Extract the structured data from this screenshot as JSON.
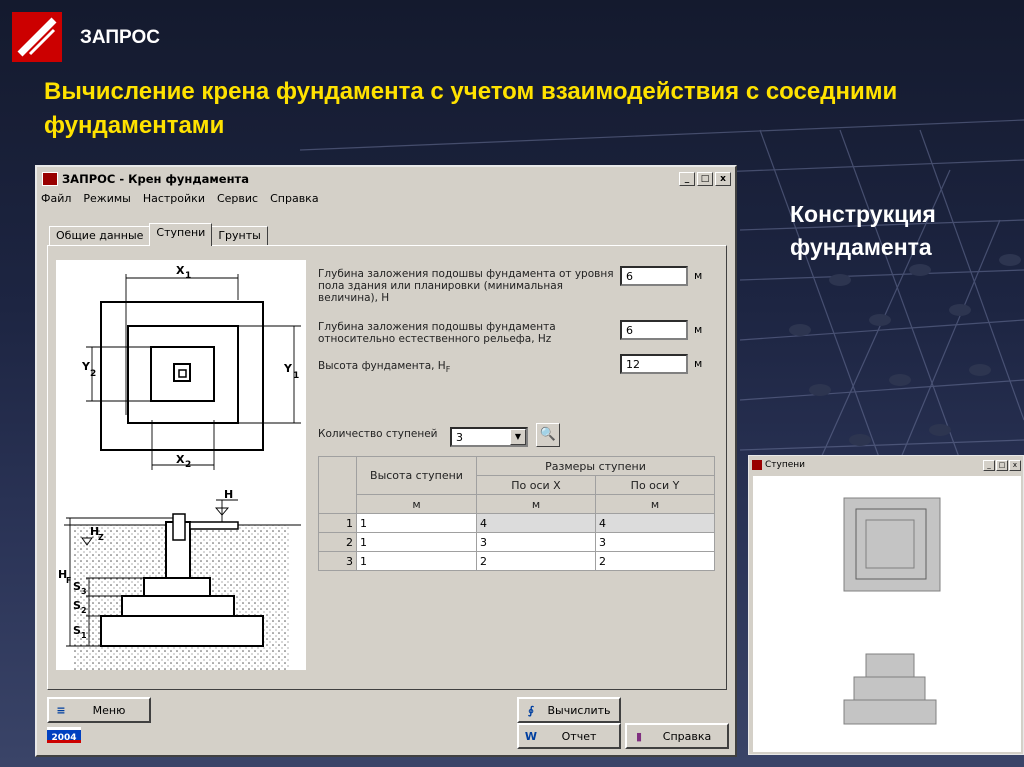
{
  "slide": {
    "tag": "ЗАПРОС",
    "title": "Вычисление крена фундамента с учетом взаимодействия с соседними фундаментами",
    "side_caption_line1": "Конструкция",
    "side_caption_line2": "фундамента"
  },
  "window": {
    "title": "ЗАПРОС - Крен фундамента",
    "controls": [
      "_",
      "□",
      "x"
    ],
    "menu": [
      "Файл",
      "Режимы",
      "Настройки",
      "Сервис",
      "Справка"
    ],
    "tabs": [
      "Общие данные",
      "Ступени",
      "Грунты"
    ],
    "active_tab": "Ступени"
  },
  "drawing": {
    "plan_labels": {
      "x1": "X",
      "x1_sub": "1",
      "x2": "X",
      "x2_sub": "2",
      "y1": "Y",
      "y1_sub": "1",
      "y2": "Y",
      "y2_sub": "2"
    },
    "section_labels": {
      "h": "H",
      "hz": "H",
      "hz_sub": "Z",
      "hf": "H",
      "hf_sub": "F",
      "s1": "S",
      "s1_sub": "1",
      "s2": "S",
      "s2_sub": "2",
      "s3": "S",
      "s3_sub": "3"
    }
  },
  "fields": [
    {
      "label_line1": "Глубина заложения подошвы фундамента от уровня",
      "label_line2": "пола здания или планировки (минимальная",
      "label_line3": "величина), H",
      "value": "6",
      "unit": "м"
    },
    {
      "label_line1": "Глубина заложения подошвы фундамента",
      "label_line2": "относительно естественного рельефа, Hz",
      "value": "6",
      "unit": "м"
    },
    {
      "label_line1": "Высота фундамента, H",
      "label_sub": "F",
      "value": "12",
      "unit": "м"
    }
  ],
  "steps_count": {
    "label": "Количество ступеней",
    "value": "3"
  },
  "table": {
    "col_height": "Высота ступени",
    "col_sizes": "Размеры ступени",
    "col_x": "По оси X",
    "col_y": "По оси Y",
    "unit_h": "м",
    "unit_x": "м",
    "unit_y": "м",
    "rows": [
      {
        "n": "1",
        "h": "1",
        "x": "4",
        "y": "4"
      },
      {
        "n": "2",
        "h": "1",
        "x": "3",
        "y": "3"
      },
      {
        "n": "3",
        "h": "1",
        "x": "2",
        "y": "2"
      }
    ]
  },
  "buttons": {
    "menu": "Меню",
    "calculate": "Вычислить",
    "report": "Отчет",
    "help": "Справка",
    "year": "2004"
  },
  "window2": {
    "title": "Ступени",
    "controls": [
      "_",
      "□",
      "x"
    ]
  }
}
